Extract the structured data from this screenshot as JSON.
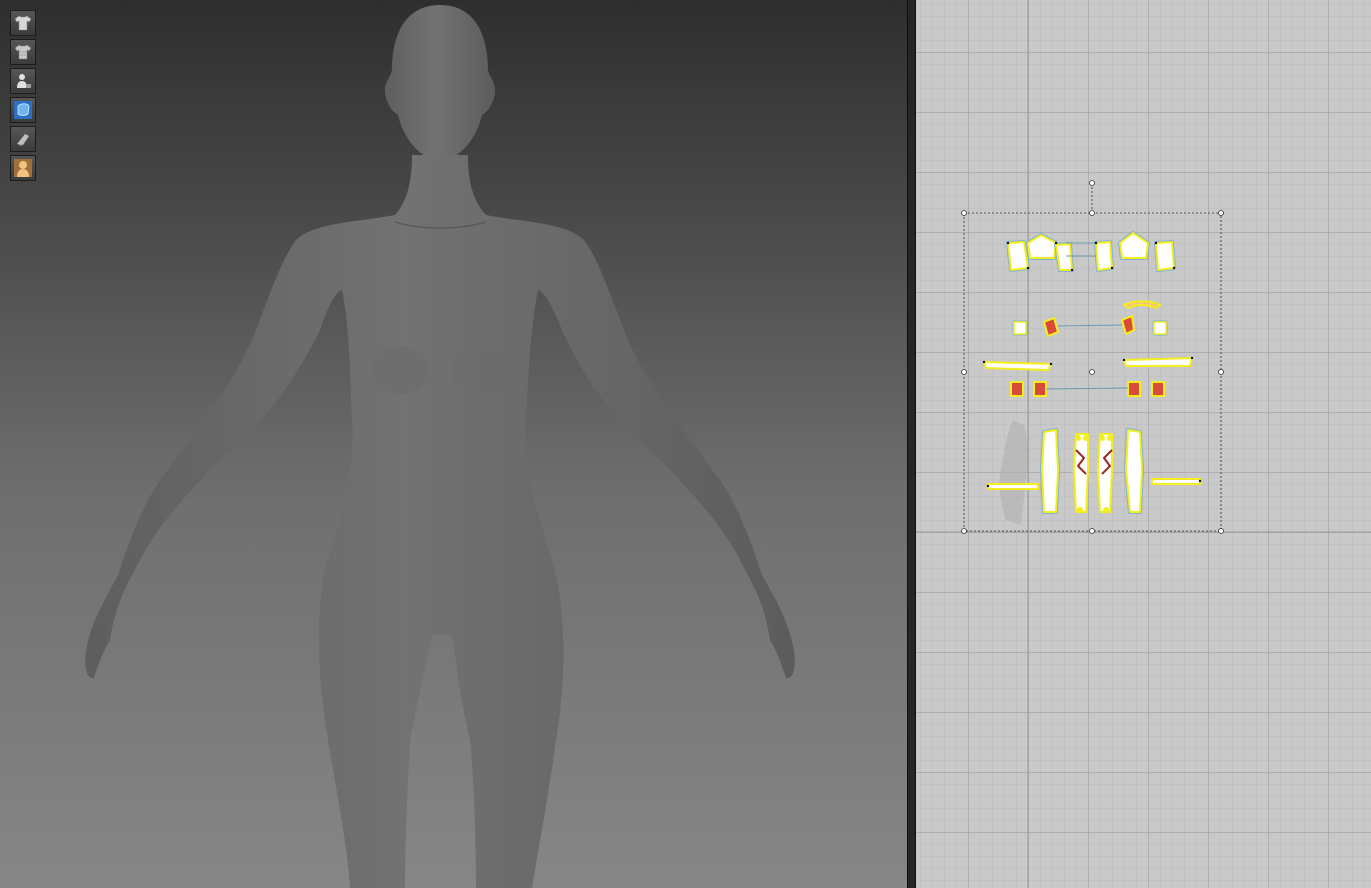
{
  "toolbar_3d": {
    "tools": [
      {
        "icon": "garment-shirt-icon",
        "color": "#d8d8d8"
      },
      {
        "icon": "garment-shirt-texture-icon",
        "color": "#c8c8c8"
      },
      {
        "icon": "avatar-display-icon",
        "color": "#e0e0e0"
      },
      {
        "icon": "garment-solid-blue-icon",
        "color": "#3b8fe0"
      },
      {
        "icon": "garment-mesh-icon",
        "color": "#bfbfbf"
      },
      {
        "icon": "avatar-skin-icon",
        "color": "#e8a85a"
      }
    ]
  },
  "colors": {
    "viewport_top": "#2e2e2e",
    "viewport_bottom": "#868686",
    "avatar_fill": "#6a6a6a",
    "pattern_bg": "#c9c9c9",
    "pattern_outline_yellow": "#f4ee1e",
    "pattern_outline_blue": "#7fb3d8",
    "pattern_fill": "#ffffff",
    "pin_red": "#b04040"
  }
}
